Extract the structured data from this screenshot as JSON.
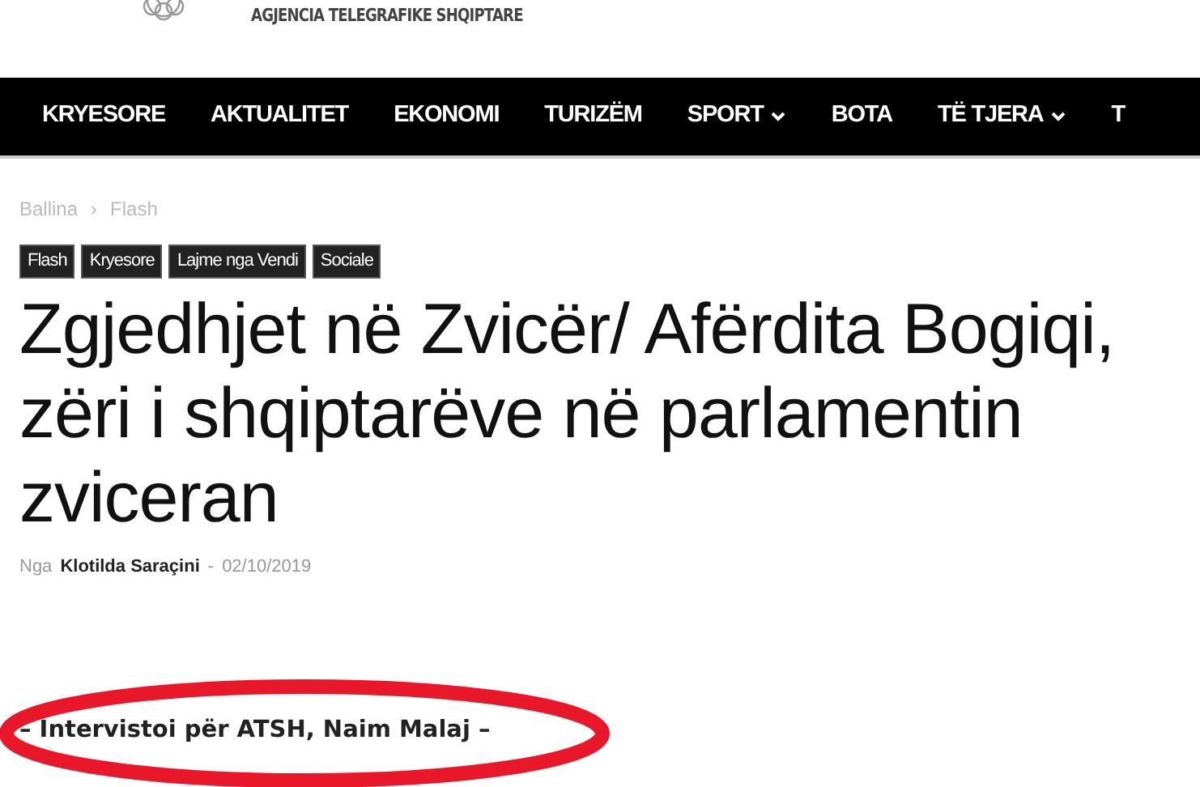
{
  "header": {
    "agency_name": "AGJENCIA TELEGRAFIKE SHQIPTARE"
  },
  "nav": [
    {
      "label": "KRYESORE",
      "dropdown": false
    },
    {
      "label": "AKTUALITET",
      "dropdown": false
    },
    {
      "label": "EKONOMI",
      "dropdown": false
    },
    {
      "label": "TURIZËM",
      "dropdown": false
    },
    {
      "label": "SPORT",
      "dropdown": true
    },
    {
      "label": "BOTA",
      "dropdown": false
    },
    {
      "label": "TË TJERA",
      "dropdown": true
    },
    {
      "label": "T",
      "dropdown": false
    }
  ],
  "breadcrumb": [
    {
      "label": "Ballina"
    },
    {
      "label": "›"
    },
    {
      "label": "Flash"
    }
  ],
  "tags": [
    "Flash",
    "Kryesore",
    "Lajme nga Vendi",
    "Sociale"
  ],
  "article": {
    "title": "Zgjedhjet në Zvicër/ Afërdita Bogiqi, zëri i shqiptarëve në parlamentin zviceran",
    "by": "Nga",
    "author": "Klotilda Saraçini",
    "separator": "-",
    "date": "02/10/2019",
    "subtitle": "– Intervistoi për ATSH, Naim Malaj –"
  }
}
